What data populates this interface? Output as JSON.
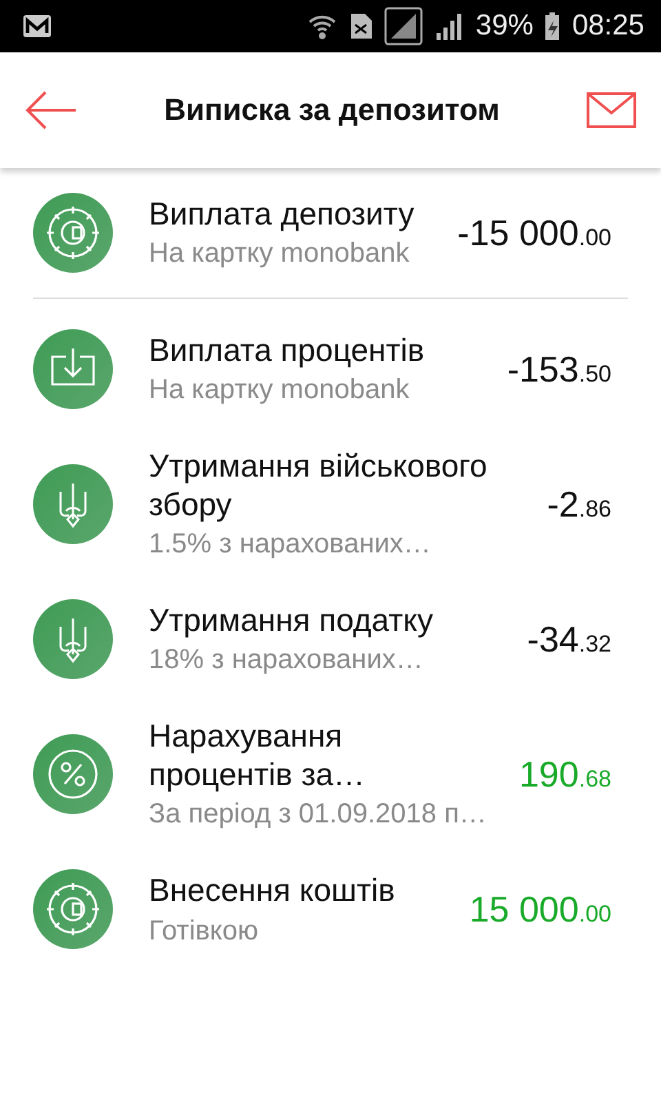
{
  "status_bar": {
    "battery": "39%",
    "time": "08:25"
  },
  "app_bar": {
    "title": "Виписка за депозитом"
  },
  "transactions": [
    {
      "kind": "safe",
      "title": "Виплата депозиту",
      "subtitle": "На картку monobank",
      "amount": "-15 000",
      "cents": ".00",
      "color": "#111111",
      "divider": true
    },
    {
      "kind": "download",
      "title": "Виплата процентів",
      "subtitle": "На картку monobank",
      "amount": "-153",
      "cents": ".50",
      "color": "#111111",
      "divider": false
    },
    {
      "kind": "trident",
      "title": "Утримання військового збору",
      "subtitle": "1.5% з нарахованих…",
      "amount": "-2",
      "cents": ".86",
      "color": "#111111",
      "divider": false
    },
    {
      "kind": "trident",
      "title": "Утримання податку",
      "subtitle": "18% з нарахованих…",
      "amount": "-34",
      "cents": ".32",
      "color": "#111111",
      "divider": false
    },
    {
      "kind": "percent",
      "title": "Нарахування процентів за…",
      "subtitle": "За період з 01.09.2018 п…",
      "amount": "190",
      "cents": ".68",
      "color": "#1aaa2a",
      "divider": false
    },
    {
      "kind": "safe",
      "title": "Внесення коштів",
      "subtitle": "Готівкою",
      "amount": "15 000",
      "cents": ".00",
      "color": "#1aaa2a",
      "divider": false
    }
  ]
}
